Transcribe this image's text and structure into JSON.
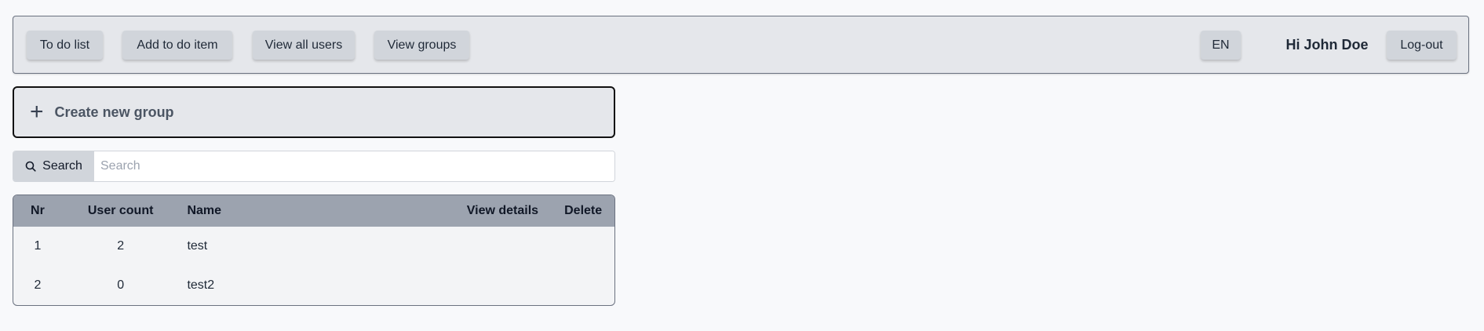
{
  "navbar": {
    "todo_list": "To do list",
    "add_todo": "Add to do item",
    "view_users": "View all users",
    "view_groups": "View groups",
    "language": "EN",
    "greeting": "Hi John Doe",
    "logout": "Log-out"
  },
  "create_group": {
    "icon": "plus-icon",
    "label": "Create new group"
  },
  "search": {
    "icon": "search-icon",
    "label": "Search",
    "placeholder": "Search",
    "value": ""
  },
  "table": {
    "headers": [
      "Nr",
      "User count",
      "Name",
      "View details",
      "Delete"
    ],
    "rows": [
      {
        "nr": "1",
        "count": "2",
        "name": "test"
      },
      {
        "nr": "2",
        "count": "0",
        "name": "test2"
      }
    ]
  },
  "colors": {
    "background": "#f8f9fb",
    "navbar_bg": "#e5e7eb",
    "button_bg": "#d1d5db",
    "table_header_bg": "#9ca3af",
    "table_body_bg": "#f3f4f6"
  }
}
